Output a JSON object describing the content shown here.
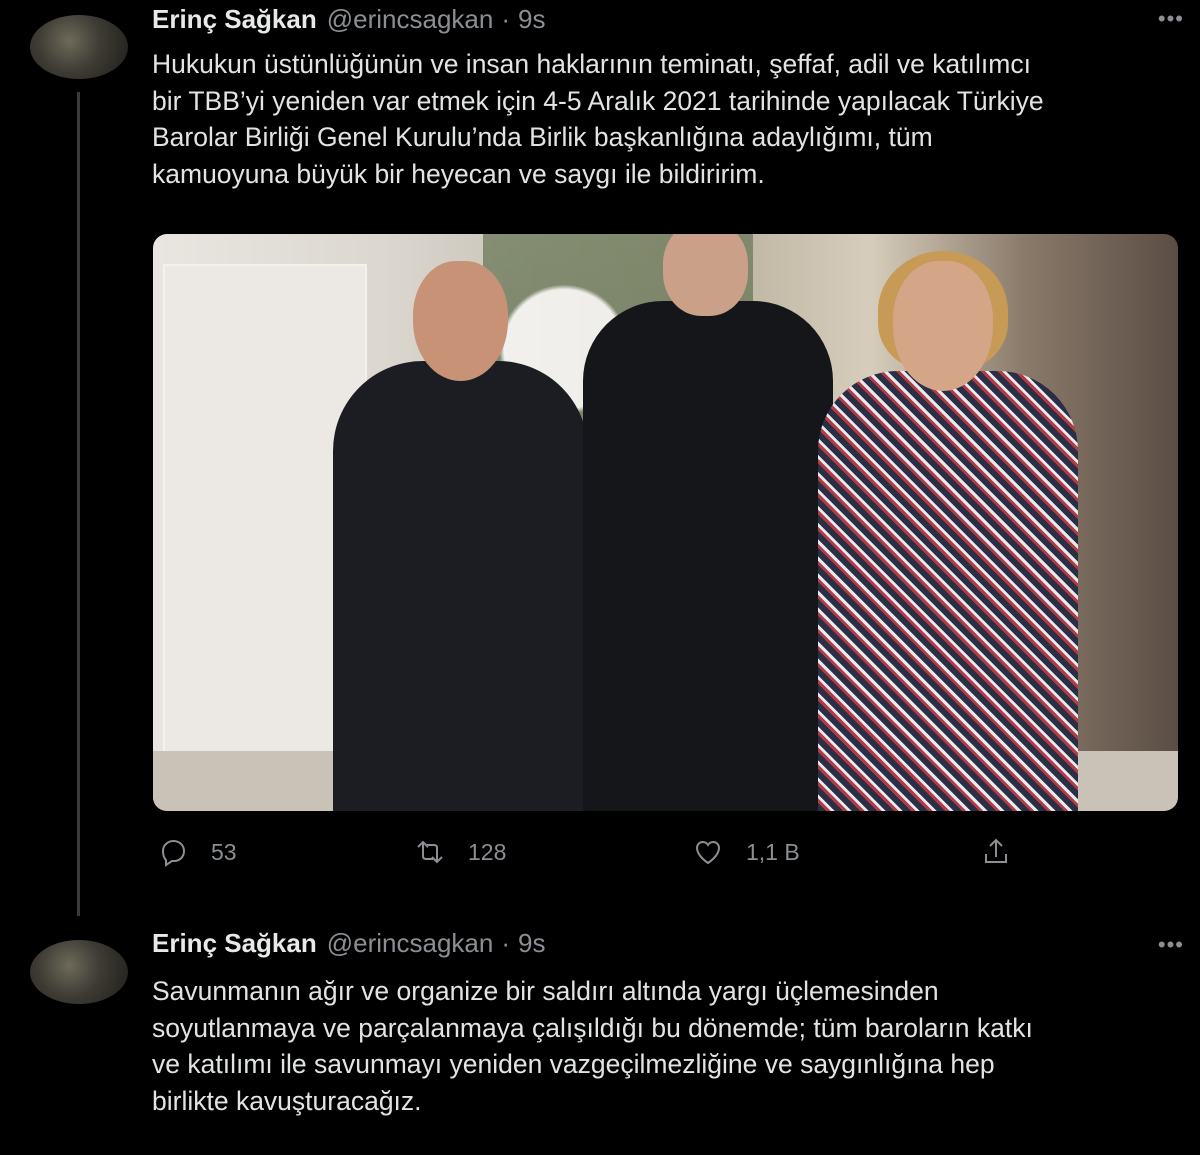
{
  "tweets": [
    {
      "author_name": "Erinç Sağkan",
      "handle": "@erincsagkan",
      "separator": "·",
      "time": "9s",
      "more": "•••",
      "text_lines": [
        "Hukukun üstünlüğünün ve insan haklarının teminatı, şeffaf, adil ve katılımcı",
        "bir TBB’yi yeniden var etmek için 4-5 Aralık 2021 tarihinde yapılacak Türkiye",
        "Barolar Birliği Genel Kurulu’nda Birlik başkanlığına adaylığımı, tüm",
        "kamuoyuna büyük bir heyecan ve saygı ile bildiririm."
      ],
      "actions": {
        "replies": "53",
        "retweets": "128",
        "likes": "1,1 B"
      }
    },
    {
      "author_name": "Erinç Sağkan",
      "handle": "@erincsagkan",
      "separator": "·",
      "time": "9s",
      "more": "•••",
      "text_lines": [
        "Savunmanın ağır ve organize bir saldırı altında yargı üçlemesinden",
        "soyutlanmaya ve parçalanmaya çalışıldığı bu dönemde; tüm baroların katkı",
        "ve katılımı ile  savunmayı yeniden vazgeçilmezliğine ve saygınlığına hep",
        "birlikte kavuşturacağız."
      ]
    }
  ],
  "icons": {
    "reply": "reply-icon",
    "retweet": "retweet-icon",
    "like": "heart-icon",
    "share": "share-icon"
  },
  "colors": {
    "background": "#000000",
    "text": "#e1e3e4",
    "secondary": "#8b8f93"
  }
}
